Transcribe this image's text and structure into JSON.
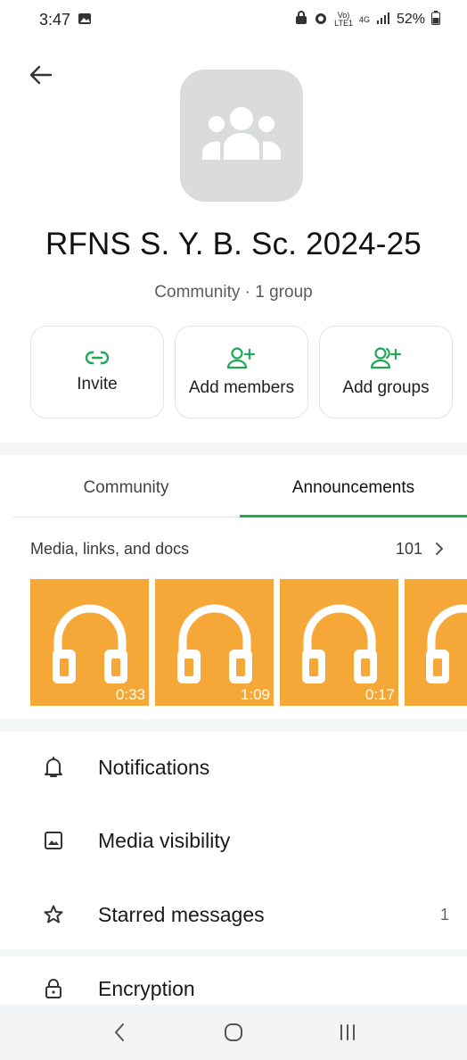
{
  "status_bar": {
    "time": "3:47",
    "net_top": "Vo)",
    "net_bottom": "LTE1",
    "network_type": "4G",
    "battery": "52%"
  },
  "header": {
    "back_icon": "arrow-left-icon"
  },
  "community": {
    "name": "RFNS S. Y. B. Sc. 2024-25",
    "subtitle": "Community · 1 group"
  },
  "actions": [
    {
      "label": "Invite",
      "icon": "link-icon"
    },
    {
      "label": "Add members",
      "icon": "person-add-icon"
    },
    {
      "label": "Add groups",
      "icon": "group-add-icon"
    }
  ],
  "tabs": [
    {
      "label": "Community",
      "active": false
    },
    {
      "label": "Announcements",
      "active": true
    }
  ],
  "media": {
    "title": "Media, links, and docs",
    "count": "101",
    "tiles": [
      {
        "duration": "0:33"
      },
      {
        "duration": "1:09"
      },
      {
        "duration": "0:17"
      },
      {
        "duration": ""
      }
    ]
  },
  "settings": [
    {
      "label": "Notifications",
      "icon": "bell-icon",
      "count": ""
    },
    {
      "label": "Media visibility",
      "icon": "image-icon",
      "count": ""
    },
    {
      "label": "Starred messages",
      "icon": "star-icon",
      "count": "1"
    },
    {
      "label": "Encryption",
      "icon": "lock-icon",
      "count": ""
    }
  ],
  "colors": {
    "accent": "#1fa855",
    "media_tile": "#f5a838",
    "avatar_bg": "#d9dbdc"
  }
}
